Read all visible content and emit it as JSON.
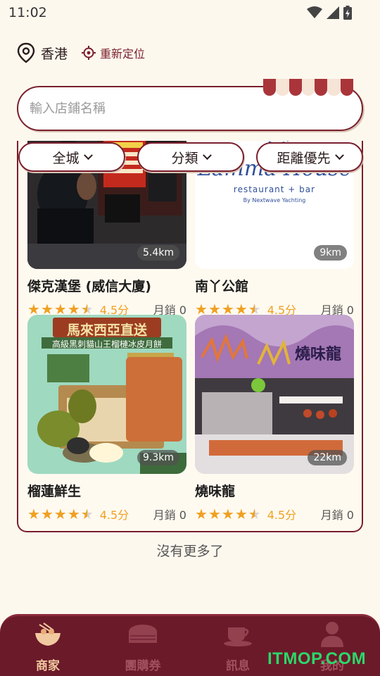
{
  "status_bar": {
    "time": "11:02",
    "icons": [
      "wifi-icon",
      "signal-icon",
      "battery-icon"
    ]
  },
  "location": {
    "city": "香港",
    "relocate_label": "重新定位",
    "icon": "map-pin-icon",
    "relocate_icon": "crosshair-icon"
  },
  "search": {
    "placeholder": "輸入店鋪名稱",
    "value": ""
  },
  "filters": [
    {
      "label": "全城"
    },
    {
      "label": "分類"
    },
    {
      "label": "距離優先"
    }
  ],
  "stores": [
    {
      "name": "傑克漢堡 (威信大廈)",
      "distance": "5.4km",
      "rating": 4.5,
      "rating_label": "4.5分",
      "sales": "月銷 0"
    },
    {
      "name": "南丫公館",
      "distance": "9km",
      "rating": 4.5,
      "rating_label": "4.5分",
      "sales": "月銷 0",
      "image_text": {
        "title": "Lamma House",
        "sub": "restaurant + bar",
        "by": "By Nextwave Yachting"
      }
    },
    {
      "name": "榴蓮鮮生",
      "distance": "9.3km",
      "rating": 4.5,
      "rating_label": "4.5分",
      "sales": "月銷 0",
      "image_text": {
        "title": "馬來西亞直送",
        "sub": "高級黑刺貓山王榴槤冰皮月餅"
      }
    },
    {
      "name": "燒味龍",
      "distance": "22km",
      "rating": 4.5,
      "rating_label": "4.5分",
      "sales": "月銷 0",
      "image_text": {
        "sign": "燒味龍"
      }
    }
  ],
  "footer_text": "沒有更多了",
  "tabs": [
    {
      "label": "商家",
      "icon": "noodle-bowl-icon",
      "active": true
    },
    {
      "label": "團購券",
      "icon": "dumpling-basket-icon",
      "active": false
    },
    {
      "label": "訊息",
      "icon": "tea-cup-icon",
      "active": false
    },
    {
      "label": "我的",
      "icon": "user-icon",
      "active": false
    }
  ],
  "watermark": "ITMOP.COM",
  "colors": {
    "brand": "#7a1f2c",
    "tabbar": "#6b1a29",
    "star": "#f0a020",
    "background": "#fdf8ee"
  }
}
